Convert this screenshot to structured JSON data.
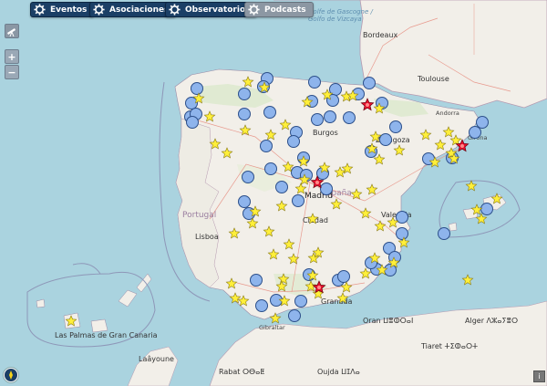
{
  "toolbar": {
    "buttons": [
      {
        "label": "Eventos",
        "state": "active"
      },
      {
        "label": "Asociaciones",
        "state": "active"
      },
      {
        "label": "Observatorios",
        "state": "active"
      },
      {
        "label": "Podcasts",
        "state": "inactive"
      }
    ]
  },
  "controls": {
    "zoom_in": "+",
    "zoom_out": "−",
    "info": "i"
  },
  "labels": {
    "golfo": "Golfe de Gascogne /",
    "golfo2": "Golfo de Vizcaya",
    "bordeaux": "Bordeaux",
    "toulouse": "Toulouse",
    "andorra": "Andorra",
    "girona": "Girona",
    "espana": "España",
    "portugal": "Portugal",
    "lisboa": "Lisboa",
    "madrid": "Madrid",
    "granada": "Granada",
    "gibraltar": "Gibraltar",
    "laayoune": "Laâyoune",
    "rabat": "Rabat ⵔⴱⴰⵟ",
    "oujda": "Oujda ⵡⵊⴷⴰ",
    "alger": "Alger ⴷⵣⴰⵢⴻⵔ",
    "oran": "Oran ⵡⴻⵀⵔⴰⵏ",
    "tiaret": "Tiaret ⵜⵉⵀⴰⵔⵜ",
    "canaria": "Las Palmas de Gran Canaria",
    "burgos": "Burgos",
    "ciudad": "Ciudad",
    "valencia": "Valencia",
    "zaragoza": "Zaragoza"
  },
  "legend_colors": {
    "association": "#8eb4ec",
    "observatory": "#ffef3a",
    "event": "#e8112d"
  },
  "markers": {
    "associations": 58,
    "observatories": 72,
    "events": 4
  }
}
